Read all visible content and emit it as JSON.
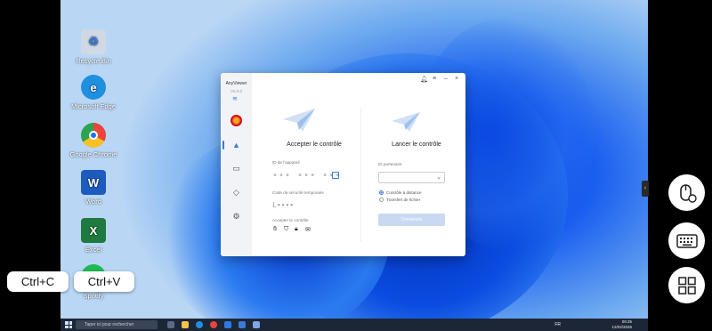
{
  "desktop": {
    "icons": [
      {
        "label": "Recycle Bin",
        "icon": "recycle-bin-icon",
        "color": "#cfd8e3"
      },
      {
        "label": "Microsoft Edge",
        "icon": "edge-icon",
        "color": "#1f8fe0"
      },
      {
        "label": "Google Chrome",
        "icon": "chrome-icon",
        "color": "#e8453c"
      },
      {
        "label": "Word",
        "icon": "word-icon",
        "color": "#1e5bbf",
        "glyph": "W"
      },
      {
        "label": "Excel",
        "icon": "excel-icon",
        "color": "#1e7a3f",
        "glyph": "X"
      },
      {
        "label": "Spotify",
        "icon": "spotify-icon",
        "color": "#1db954"
      }
    ]
  },
  "anyviewer": {
    "brand": "AnyViewer",
    "version": "V5.0.0",
    "accept_title": "Accepter le contrôle",
    "device_id_label": "ID de l'appareil",
    "device_id_value": "∙∙∙ ∙∙∙ ∙∙∙",
    "temp_code_label": "Code de sécurité temporaire",
    "temp_code_value": "L∙∙∙∙",
    "accept_control_label": "Accepter le contrôle",
    "launch_title": "Lancer le contrôle",
    "partner_id_label": "ID partenaire",
    "remote_control_label": "Contrôle à distance",
    "file_transfer_label": "Transfert de fichier",
    "connect_label": "Connexion"
  },
  "taskbar": {
    "search_placeholder": "Taper ici pour rechercher",
    "lang": "FR",
    "time": "09:35",
    "date": "12/02/2026"
  },
  "overlay": {
    "ctrl_c": "Ctrl+C",
    "ctrl_v": "Ctrl+V",
    "side_tab": "‹"
  },
  "colors": {
    "accent": "#3a7bd5",
    "taskbar": "#1d2636"
  }
}
